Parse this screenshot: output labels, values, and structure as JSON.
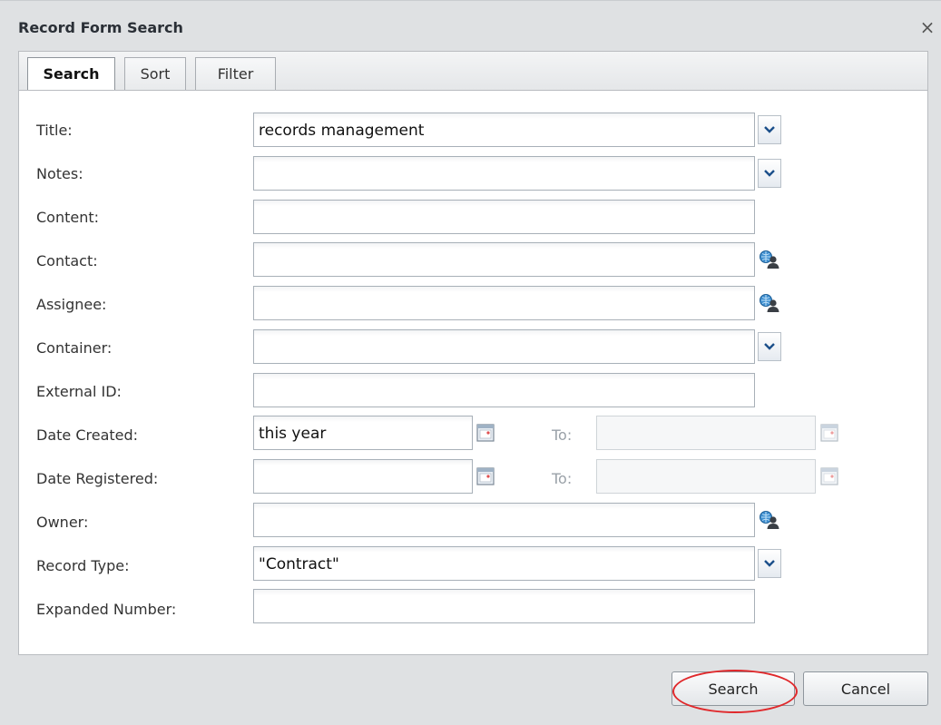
{
  "dialog": {
    "title": "Record Form Search",
    "close_glyph": "×"
  },
  "tabs": [
    {
      "label": "Search",
      "active": true
    },
    {
      "label": "Sort",
      "active": false
    },
    {
      "label": "Filter",
      "active": false
    }
  ],
  "form": {
    "title": {
      "label": "Title:",
      "value": "records management",
      "trigger": "chevron-down-icon"
    },
    "notes": {
      "label": "Notes:",
      "value": "",
      "trigger": "chevron-down-icon"
    },
    "content": {
      "label": "Content:",
      "value": ""
    },
    "contact": {
      "label": "Contact:",
      "value": "",
      "trigger": "contact-lookup-icon"
    },
    "assignee": {
      "label": "Assignee:",
      "value": "",
      "trigger": "contact-lookup-icon"
    },
    "container": {
      "label": "Container:",
      "value": "",
      "trigger": "chevron-down-icon"
    },
    "external_id": {
      "label": "External ID:",
      "value": ""
    },
    "date_created": {
      "label": "Date Created:",
      "value": "this year",
      "to_label": "To:",
      "to_value": "",
      "trigger": "calendar-icon"
    },
    "date_registered": {
      "label": "Date Registered:",
      "value": "",
      "to_label": "To:",
      "to_value": "",
      "trigger": "calendar-icon"
    },
    "owner": {
      "label": "Owner:",
      "value": "",
      "trigger": "contact-lookup-icon"
    },
    "record_type": {
      "label": "Record Type:",
      "value": "\"Contract\"",
      "trigger": "chevron-down-icon"
    },
    "expanded_number": {
      "label": "Expanded Number:",
      "value": ""
    }
  },
  "footer": {
    "search_label": "Search",
    "cancel_label": "Cancel"
  },
  "colors": {
    "highlight": "#e0282b",
    "dialog_bg": "#dfe1e3"
  }
}
